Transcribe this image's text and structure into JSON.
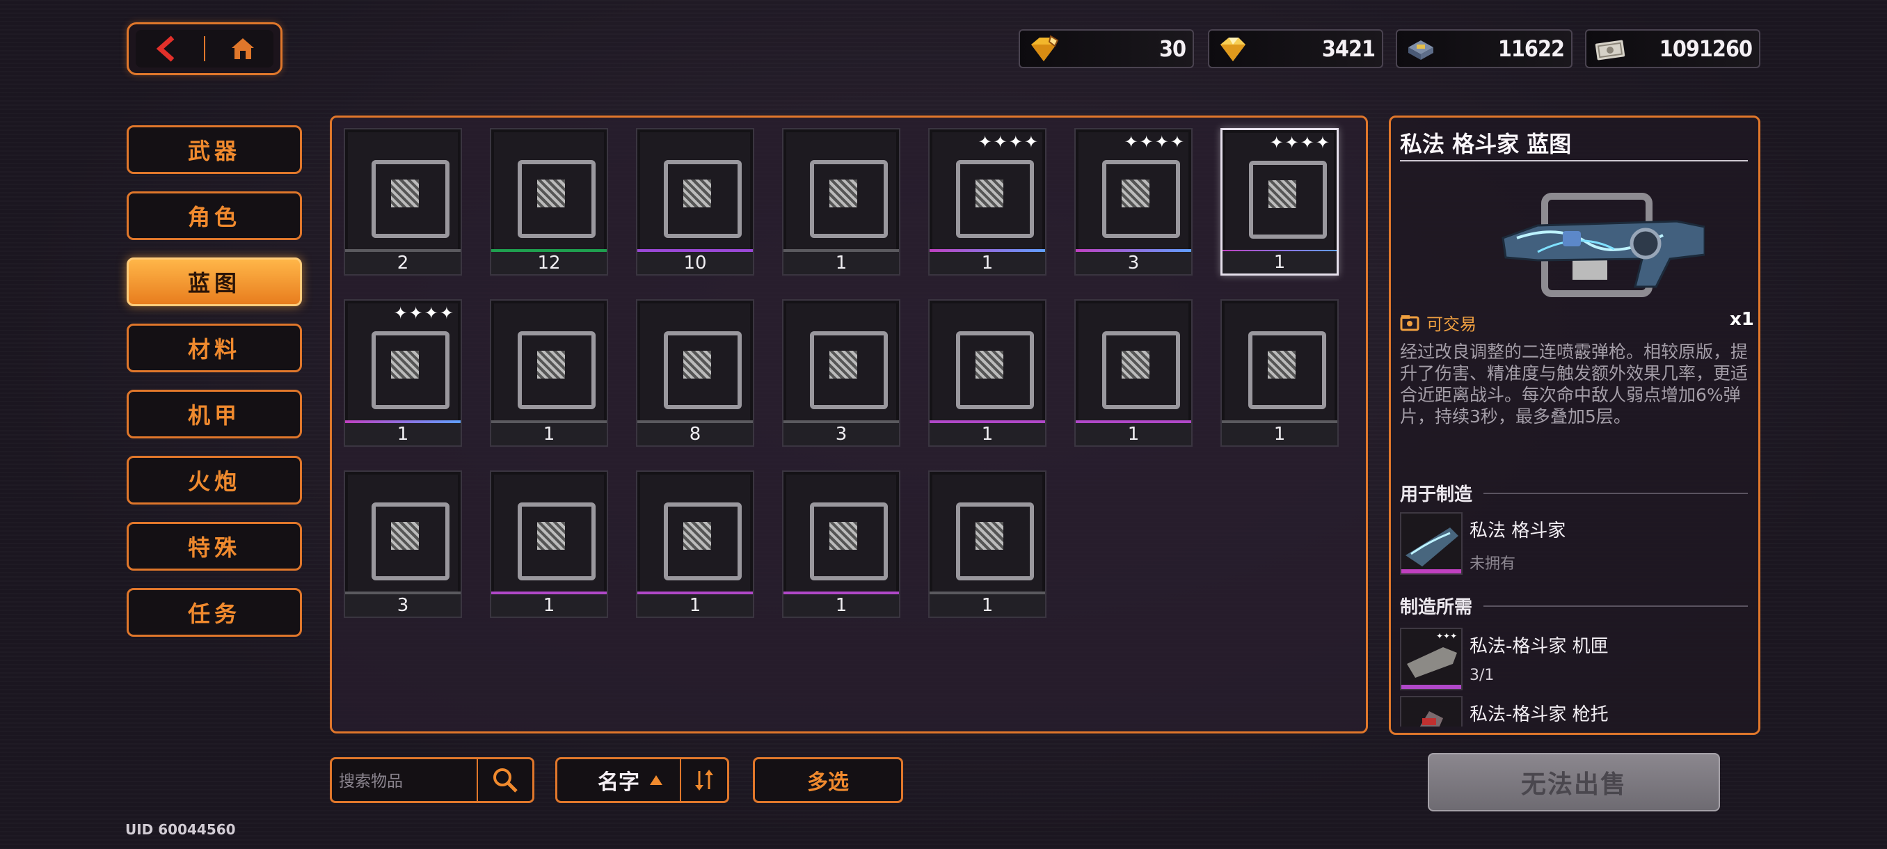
{
  "currencies": [
    {
      "icon": "gold-diamond-key-icon",
      "value": "30"
    },
    {
      "icon": "gold-diamond-icon",
      "value": "3421"
    },
    {
      "icon": "chip-stack-icon",
      "value": "11622"
    },
    {
      "icon": "banknote-icon",
      "value": "1091260"
    }
  ],
  "menu": [
    {
      "label": "武器",
      "active": false
    },
    {
      "label": "角色",
      "active": false
    },
    {
      "label": "蓝图",
      "active": true
    },
    {
      "label": "材料",
      "active": false
    },
    {
      "label": "机甲",
      "active": false
    },
    {
      "label": "火炮",
      "active": false
    },
    {
      "label": "特殊",
      "active": false
    },
    {
      "label": "任务",
      "active": false
    }
  ],
  "items": [
    {
      "count": "2",
      "stars": "",
      "icon": "smg-blueprint-icon",
      "rarity": "#5b5a5f"
    },
    {
      "count": "12",
      "stars": "",
      "icon": "lantern-badge-icon",
      "rarity": "#1fa04f"
    },
    {
      "count": "10",
      "stars": "",
      "icon": "rocket-launcher-icon",
      "rarity": "#9a48d6"
    },
    {
      "count": "1",
      "stars": "",
      "icon": "pistol-blueprint-icon",
      "rarity": "#5b5a5f"
    },
    {
      "count": "1",
      "stars": "✦✦✦✦",
      "icon": "rifle-blueprint-icon",
      "rarity": "linear-gradient(90deg,#c040c0,#60a0ff)"
    },
    {
      "count": "3",
      "stars": "✦✦✦✦",
      "icon": "shotgun-blueprint-icon",
      "rarity": "linear-gradient(90deg,#c040c0,#60a0ff)"
    },
    {
      "count": "1",
      "stars": "✦✦✦✦",
      "icon": "brawler-blueprint-icon",
      "rarity": "linear-gradient(90deg,#c040c0,#60a0ff)"
    },
    {
      "count": "1",
      "stars": "✦✦✦✦",
      "icon": "cannon-blueprint-icon",
      "rarity": "linear-gradient(90deg,#c040c0,#60a0ff)"
    },
    {
      "count": "1",
      "stars": "",
      "icon": "purple-rifle-icon",
      "rarity": "#5b5a5f"
    },
    {
      "count": "8",
      "stars": "",
      "icon": "sniper-blueprint-icon",
      "rarity": "#5b5a5f"
    },
    {
      "count": "3",
      "stars": "",
      "icon": "white-blaster-icon",
      "rarity": "#5b5a5f"
    },
    {
      "count": "1",
      "stars": "",
      "icon": "red-crate-icon",
      "rarity": "#b048c8"
    },
    {
      "count": "1",
      "stars": "",
      "icon": "coil-belt-icon",
      "rarity": "#b048c8"
    },
    {
      "count": "1",
      "stars": "",
      "icon": "character-portrait-woman-icon",
      "rarity": "#5b5a5f"
    },
    {
      "count": "3",
      "stars": "",
      "icon": "heavy-rifle-icon",
      "rarity": "#5b5a5f"
    },
    {
      "count": "1",
      "stars": "",
      "icon": "red-crate-icon",
      "rarity": "#b048c8"
    },
    {
      "count": "1",
      "stars": "",
      "icon": "chainsaw-blade-icon",
      "rarity": "#b048c8"
    },
    {
      "count": "1",
      "stars": "",
      "icon": "coil-belt-icon",
      "rarity": "#b048c8"
    },
    {
      "count": "1",
      "stars": "",
      "icon": "character-portrait-boy-icon",
      "rarity": "#5b5a5f"
    }
  ],
  "detail": {
    "title": "私法 格斗家 蓝图",
    "tradable": "可交易",
    "qty": "x1",
    "description": "经过改良调整的二连喷霰弹枪。相较原版，提升了伤害、精准度与触发额外效果几率，更适合近距离战斗。每次命中敌人弱点增加6%弹片，持续3秒，最多叠加5层。",
    "used_for_title": "用于制造",
    "used_for": {
      "name": "私法 格斗家",
      "status": "未拥有"
    },
    "requires_title": "制造所需",
    "requires": [
      {
        "name": "私法-格斗家 机匣",
        "qty": "3/1"
      },
      {
        "name": "私法-格斗家 枪托",
        "qty": ""
      }
    ]
  },
  "search": {
    "placeholder": "搜索物品"
  },
  "sort": {
    "label": "名字"
  },
  "multi_select": "多选",
  "sell_button": "无法出售",
  "uid": "UID 60044560"
}
